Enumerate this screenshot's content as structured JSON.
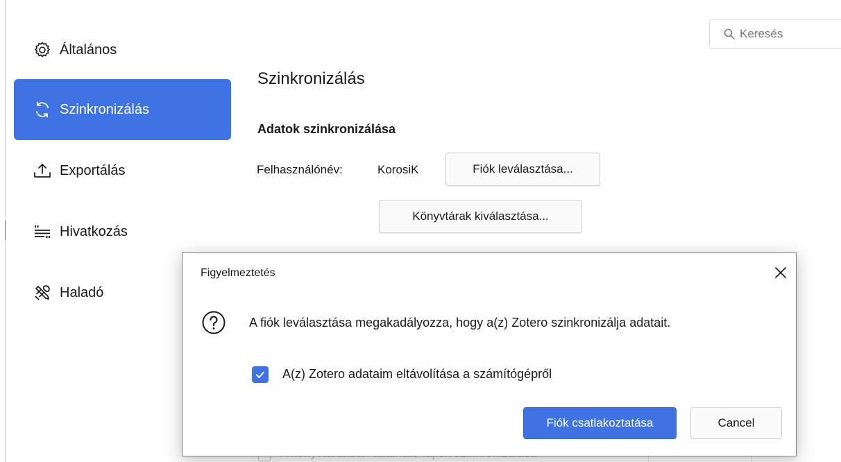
{
  "search": {
    "placeholder": "Keresés"
  },
  "sidebar": {
    "items": [
      {
        "label": "Általános",
        "icon": "gear-icon",
        "active": false
      },
      {
        "label": "Szinkronizálás",
        "icon": "sync-icon",
        "active": true
      },
      {
        "label": "Exportálás",
        "icon": "export-icon",
        "active": false
      },
      {
        "label": "Hivatkozás",
        "icon": "cite-icon",
        "active": false
      },
      {
        "label": "Haladó",
        "icon": "tools-icon",
        "active": false
      }
    ]
  },
  "main": {
    "title": "Szinkronizálás",
    "section_title": "Adatok szinkronizálása",
    "username_label": "Felhasználónév:",
    "username_value": "KorosiK",
    "unlink_button": "Fiók leválasztása...",
    "choose_libraries_button": "Könyvtárak kiválasztása...",
    "hidden_row_text": "A könyvtárakban található fájlok szinkronizálása"
  },
  "dialog": {
    "title": "Figyelmeztetés",
    "message": "A fiók leválasztása megakadályozza, hogy a(z) Zotero szinkronizálja adatait.",
    "checkbox_label": "A(z) Zotero adataim eltávolítása a számítógépről",
    "checkbox_checked": true,
    "primary_button": "Fiók csatlakoztatása",
    "cancel_button": "Cancel"
  },
  "colors": {
    "accent": "#3f72e3",
    "text": "#1a1a1a",
    "border": "#d0d0d0"
  }
}
